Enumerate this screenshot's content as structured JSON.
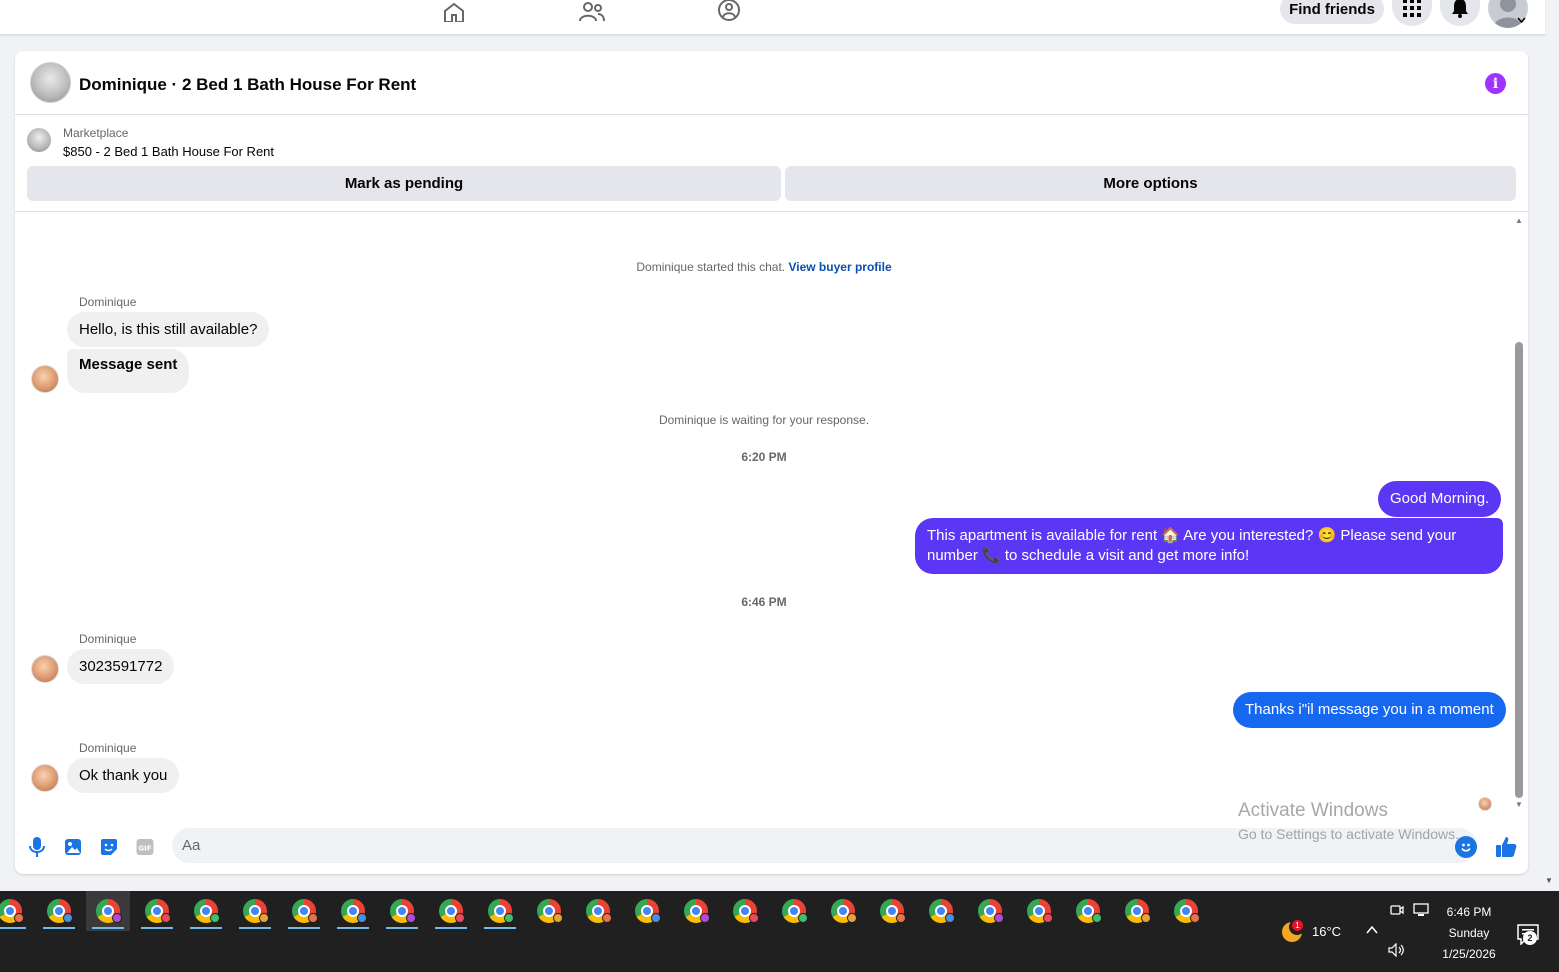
{
  "topnav": {
    "find_friends_label": "Find friends"
  },
  "chat": {
    "title": "Dominique · 2 Bed 1 Bath House For Rent",
    "listing": {
      "kind": "Marketplace",
      "description": "$850 - 2 Bed 1 Bath House For Rent"
    },
    "actions": {
      "mark_pending": "Mark as pending",
      "more_options": "More options"
    },
    "system": {
      "started": "Dominique started this chat.",
      "view_profile": "View buyer profile",
      "waiting": "Dominique is waiting for your response."
    },
    "timestamps": [
      "6:20 PM",
      "6:46 PM"
    ],
    "messages": {
      "m1_sender": "Dominique",
      "m1_text1": "Hello, is this still available?",
      "m1_text2": "Message sent",
      "out1": "Good Morning.",
      "out2": "This apartment is available for rent 🏠 Are you interested? 😊 Please send your number 📞 to schedule a visit and get more info!",
      "m2_sender": "Dominique",
      "m2_text": "3023591772",
      "out3": "Thanks i\"il message you in a moment",
      "m3_sender": "Dominique",
      "m3_text": "Ok thank you"
    },
    "composer": {
      "placeholder": "Aa"
    },
    "colors": {
      "outgoing_purple": "#5b37f5",
      "outgoing_blue": "#1768f0",
      "incoming_gray": "#f0f0f0",
      "info_purple": "#a033ff"
    }
  },
  "watermark": {
    "title": "Activate Windows",
    "subtitle": "Go to Settings to activate Windows."
  },
  "taskbar": {
    "app_count": 25,
    "weather_badge": "1",
    "temperature": "16°C",
    "time": "6:46 PM",
    "day": "Sunday",
    "date": "1/25/2026",
    "notification_count": "2"
  }
}
